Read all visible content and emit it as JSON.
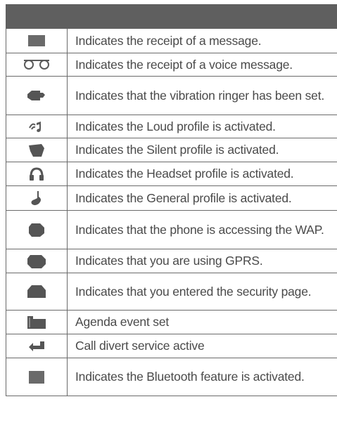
{
  "table": {
    "rows": [
      {
        "icon": "message-icon",
        "text": "Indicates the receipt of a message."
      },
      {
        "icon": "voicemail-icon",
        "text": "Indicates the receipt of a voice message."
      },
      {
        "icon": "vibration-ringer-icon",
        "text": "Indicates that the vibration ringer has been set."
      },
      {
        "icon": "loud-profile-icon",
        "text": "Indicates the Loud profile is activated."
      },
      {
        "icon": "silent-profile-icon",
        "text": "Indicates the Silent profile is activated."
      },
      {
        "icon": "headset-profile-icon",
        "text": "Indicates the Headset profile is activated."
      },
      {
        "icon": "general-profile-icon",
        "text": "Indicates the General profile is activated."
      },
      {
        "icon": "wap-access-icon",
        "text": "Indicates that the phone is accessing the WAP."
      },
      {
        "icon": "gprs-icon",
        "text": "Indicates that you are using GPRS."
      },
      {
        "icon": "security-page-icon",
        "text": "Indicates that you entered the security page."
      },
      {
        "icon": "agenda-event-icon",
        "text": "Agenda event set"
      },
      {
        "icon": "call-divert-icon",
        "text": "Call divert service active"
      },
      {
        "icon": "bluetooth-icon",
        "text": "Indicates the Bluetooth feature is activated."
      }
    ]
  }
}
